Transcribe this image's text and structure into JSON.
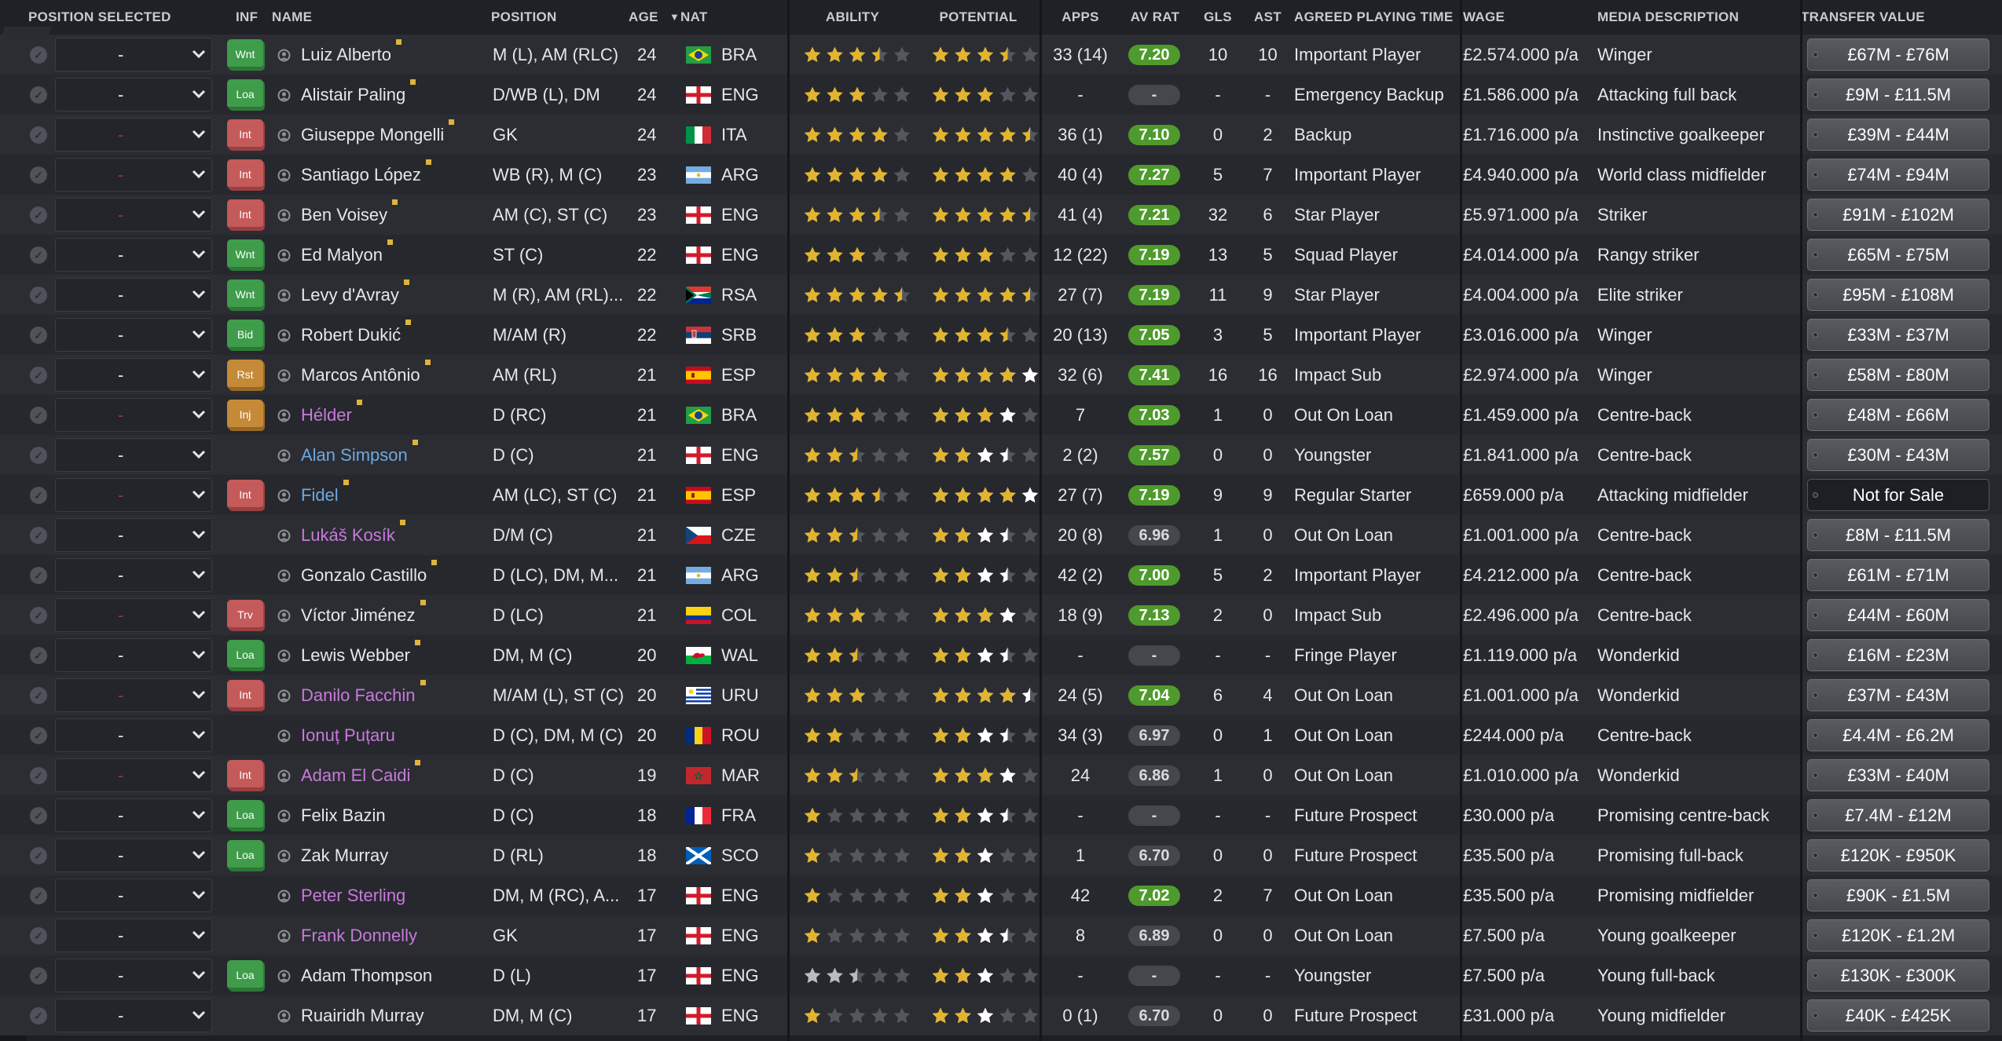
{
  "headers": {
    "position_selected": "POSITION SELECTED",
    "inf": "INF",
    "name": "NAME",
    "position": "POSITION",
    "age": "AGE",
    "nat": "NAT",
    "ability": "ABILITY",
    "potential": "POTENTIAL",
    "apps": "APPS",
    "av_rat": "AV RAT",
    "gls": "GLS",
    "ast": "AST",
    "agreed_playing_time": "AGREED PLAYING TIME",
    "wage": "WAGE",
    "media_description": "MEDIA DESCRIPTION",
    "transfer_value": "TRANSFER VALUE"
  },
  "sort": {
    "column": "age",
    "direction": "descending"
  },
  "colors": {
    "star_gold": "#e2b42f",
    "star_white": "#ffffff",
    "star_grey": "#55575e",
    "star_silver": "#b9bbc1",
    "rating_green": "#4f9a2c",
    "rating_grey": "#45474e",
    "name_purple": "#c77ad9",
    "name_blue": "#6fa8dc"
  },
  "players": [
    {
      "sel": "-",
      "sel_red": false,
      "badge": "Wnt",
      "badge_color": "green",
      "name": "Luiz Alberto",
      "name_color": "white",
      "dot": true,
      "position": "M (L), AM (RLC)",
      "age": "24",
      "flag": "brazil",
      "nat": "BRA",
      "ability": 3.5,
      "ability_color": "gold",
      "potential": 3.5,
      "potential_color": "gold",
      "apps": "33 (14)",
      "av_rat": "7.20",
      "rat_color": "green",
      "gls": "10",
      "ast": "10",
      "apt": "Important Player",
      "wage": "£2.574.000 p/a",
      "media": "Winger",
      "tv": "£67M - £76M"
    },
    {
      "sel": "-",
      "sel_red": false,
      "badge": "Loa",
      "badge_color": "green",
      "name": "Alistair Paling",
      "name_color": "white",
      "dot": true,
      "position": "D/WB (L), DM",
      "age": "24",
      "flag": "england",
      "nat": "ENG",
      "ability": 3,
      "ability_color": "gold",
      "potential": 3,
      "potential_color": "gold",
      "apps": "-",
      "av_rat": "-",
      "rat_color": "grey",
      "gls": "-",
      "ast": "-",
      "apt": "Emergency Backup",
      "wage": "£1.586.000 p/a",
      "media": "Attacking full back",
      "tv": "£9M - £11.5M"
    },
    {
      "sel": "-",
      "sel_red": true,
      "badge": "Int",
      "badge_color": "red",
      "name": "Giuseppe Mongelli",
      "name_color": "white",
      "dot": true,
      "position": "GK",
      "age": "24",
      "flag": "italy",
      "nat": "ITA",
      "ability": 4,
      "ability_color": "gold",
      "potential": 4.5,
      "potential_color": "gold",
      "apps": "36 (1)",
      "av_rat": "7.10",
      "rat_color": "green",
      "gls": "0",
      "ast": "2",
      "apt": "Backup",
      "wage": "£1.716.000 p/a",
      "media": "Instinctive goalkeeper",
      "tv": "£39M - £44M"
    },
    {
      "sel": "-",
      "sel_red": true,
      "badge": "Int",
      "badge_color": "red",
      "name": "Santiago López",
      "name_color": "white",
      "dot": true,
      "position": "WB (R), M (C)",
      "age": "23",
      "flag": "argentina",
      "nat": "ARG",
      "ability": 4,
      "ability_color": "gold",
      "potential": 4,
      "potential_color": "gold",
      "apps": "40 (4)",
      "av_rat": "7.27",
      "rat_color": "green",
      "gls": "5",
      "ast": "7",
      "apt": "Important Player",
      "wage": "£4.940.000 p/a",
      "media": "World class midfielder",
      "tv": "£74M - £94M"
    },
    {
      "sel": "-",
      "sel_red": true,
      "badge": "Int",
      "badge_color": "red",
      "name": "Ben Voisey",
      "name_color": "white",
      "dot": true,
      "position": "AM (C), ST (C)",
      "age": "23",
      "flag": "england",
      "nat": "ENG",
      "ability": 3.5,
      "ability_color": "gold",
      "potential": 4.5,
      "potential_color": "gold",
      "apps": "41 (4)",
      "av_rat": "7.21",
      "rat_color": "green",
      "gls": "32",
      "ast": "6",
      "apt": "Star Player",
      "wage": "£5.971.000 p/a",
      "media": "Striker",
      "tv": "£91M - £102M"
    },
    {
      "sel": "-",
      "sel_red": false,
      "badge": "Wnt",
      "badge_color": "green",
      "name": "Ed Malyon",
      "name_color": "white",
      "dot": true,
      "position": "ST (C)",
      "age": "22",
      "flag": "england",
      "nat": "ENG",
      "ability": 3,
      "ability_color": "gold",
      "potential": 3,
      "potential_color": "gold",
      "apps": "12 (22)",
      "av_rat": "7.19",
      "rat_color": "green",
      "gls": "13",
      "ast": "5",
      "apt": "Squad Player",
      "wage": "£4.014.000 p/a",
      "media": "Rangy striker",
      "tv": "£65M - £75M"
    },
    {
      "sel": "-",
      "sel_red": false,
      "badge": "Wnt",
      "badge_color": "green",
      "name": "Levy d'Avray",
      "name_color": "white",
      "dot": true,
      "position": "M (R), AM (RL)...",
      "age": "22",
      "flag": "south-africa",
      "nat": "RSA",
      "ability": 4.5,
      "ability_color": "gold",
      "potential": 4.5,
      "potential_color": "gold",
      "apps": "27 (7)",
      "av_rat": "7.19",
      "rat_color": "green",
      "gls": "11",
      "ast": "9",
      "apt": "Star Player",
      "wage": "£4.004.000 p/a",
      "media": "Elite striker",
      "tv": "£95M - £108M"
    },
    {
      "sel": "-",
      "sel_red": false,
      "badge": "Bid",
      "badge_color": "green",
      "name": "Robert Dukić",
      "name_color": "white",
      "dot": true,
      "position": "M/AM (R)",
      "age": "22",
      "flag": "serbia",
      "nat": "SRB",
      "ability": 3,
      "ability_color": "gold",
      "potential": 3.5,
      "potential_color": "gold",
      "apps": "20 (13)",
      "av_rat": "7.05",
      "rat_color": "green",
      "gls": "3",
      "ast": "5",
      "apt": "Important Player",
      "wage": "£3.016.000 p/a",
      "media": "Winger",
      "tv": "£33M - £37M"
    },
    {
      "sel": "-",
      "sel_red": false,
      "badge": "Rst",
      "badge_color": "yellow",
      "name": "Marcos Antônio",
      "name_color": "white",
      "dot": true,
      "position": "AM (RL)",
      "age": "21",
      "flag": "spain",
      "nat": "ESP",
      "ability": 4,
      "ability_color": "gold",
      "potential": 4,
      "potential_color": "gold",
      "potential_white": 1,
      "apps": "32 (6)",
      "av_rat": "7.41",
      "rat_color": "green",
      "gls": "16",
      "ast": "16",
      "apt": "Impact Sub",
      "wage": "£2.974.000 p/a",
      "media": "Winger",
      "tv": "£58M - £80M"
    },
    {
      "sel": "-",
      "sel_red": true,
      "badge": "Inj",
      "badge_color": "yellow",
      "name": "Hélder",
      "name_color": "purple",
      "dot": true,
      "position": "D (RC)",
      "age": "21",
      "flag": "brazil",
      "nat": "BRA",
      "ability": 3,
      "ability_color": "gold",
      "potential": 3,
      "potential_color": "gold",
      "potential_white": 1,
      "apps": "7",
      "av_rat": "7.03",
      "rat_color": "green",
      "gls": "1",
      "ast": "0",
      "apt": "Out On Loan",
      "wage": "£1.459.000 p/a",
      "media": "Centre-back",
      "tv": "£48M - £66M"
    },
    {
      "sel": "-",
      "sel_red": false,
      "badge": "",
      "badge_color": "",
      "name": "Alan Simpson",
      "name_color": "blue",
      "dot": true,
      "position": "D (C)",
      "age": "21",
      "flag": "england",
      "nat": "ENG",
      "ability": 2.5,
      "ability_color": "gold",
      "potential": 2,
      "potential_color": "gold",
      "potential_white": 1.5,
      "apps": "2 (2)",
      "av_rat": "7.57",
      "rat_color": "green",
      "gls": "0",
      "ast": "0",
      "apt": "Youngster",
      "wage": "£1.841.000 p/a",
      "media": "Centre-back",
      "tv": "£30M - £43M"
    },
    {
      "sel": "-",
      "sel_red": true,
      "badge": "Int",
      "badge_color": "red",
      "name": "Fidel",
      "name_color": "blue",
      "dot": true,
      "position": "AM (LC), ST (C)",
      "age": "21",
      "flag": "spain",
      "nat": "ESP",
      "ability": 3.5,
      "ability_color": "gold",
      "potential": 4,
      "potential_color": "gold",
      "potential_white": 1,
      "apps": "27 (7)",
      "av_rat": "7.19",
      "rat_color": "green",
      "gls": "9",
      "ast": "9",
      "apt": "Regular Starter",
      "wage": "£659.000 p/a",
      "media": "Attacking midfielder",
      "tv": "Not for Sale",
      "tv_dark": true
    },
    {
      "sel": "-",
      "sel_red": false,
      "badge": "",
      "badge_color": "",
      "name": "Lukáš Kosík",
      "name_color": "purple",
      "dot": true,
      "position": "D/M (C)",
      "age": "21",
      "flag": "czech",
      "nat": "CZE",
      "ability": 2.5,
      "ability_color": "gold",
      "potential": 2,
      "potential_color": "gold",
      "potential_white": 1.5,
      "apps": "20 (8)",
      "av_rat": "6.96",
      "rat_color": "grey",
      "gls": "1",
      "ast": "0",
      "apt": "Out On Loan",
      "wage": "£1.001.000 p/a",
      "media": "Centre-back",
      "tv": "£8M - £11.5M"
    },
    {
      "sel": "-",
      "sel_red": false,
      "badge": "",
      "badge_color": "",
      "name": "Gonzalo Castillo",
      "name_color": "white",
      "dot": true,
      "position": "D (LC), DM, M...",
      "age": "21",
      "flag": "argentina",
      "nat": "ARG",
      "ability": 2.5,
      "ability_color": "gold",
      "potential": 2,
      "potential_color": "gold",
      "potential_white": 1.5,
      "apps": "42 (2)",
      "av_rat": "7.00",
      "rat_color": "green",
      "gls": "5",
      "ast": "2",
      "apt": "Important Player",
      "wage": "£4.212.000 p/a",
      "media": "Centre-back",
      "tv": "£61M - £71M"
    },
    {
      "sel": "-",
      "sel_red": true,
      "badge": "Trv",
      "badge_color": "red",
      "name": "Víctor Jiménez",
      "name_color": "white",
      "dot": true,
      "position": "D (LC)",
      "age": "21",
      "flag": "colombia",
      "nat": "COL",
      "ability": 3,
      "ability_color": "gold",
      "potential": 3,
      "potential_color": "gold",
      "potential_white": 1,
      "apps": "18 (9)",
      "av_rat": "7.13",
      "rat_color": "green",
      "gls": "2",
      "ast": "0",
      "apt": "Impact Sub",
      "wage": "£2.496.000 p/a",
      "media": "Centre-back",
      "tv": "£44M - £60M"
    },
    {
      "sel": "-",
      "sel_red": false,
      "badge": "Loa",
      "badge_color": "green",
      "name": "Lewis Webber",
      "name_color": "white",
      "dot": true,
      "position": "DM, M (C)",
      "age": "20",
      "flag": "wales",
      "nat": "WAL",
      "ability": 2.5,
      "ability_color": "gold",
      "potential": 2,
      "potential_color": "gold",
      "potential_white": 1.5,
      "apps": "-",
      "av_rat": "-",
      "rat_color": "grey",
      "gls": "-",
      "ast": "-",
      "apt": "Fringe Player",
      "wage": "£1.119.000 p/a",
      "media": "Wonderkid",
      "tv": "£16M - £23M"
    },
    {
      "sel": "-",
      "sel_red": true,
      "badge": "Int",
      "badge_color": "red",
      "name": "Danilo Facchin",
      "name_color": "purple",
      "dot": true,
      "position": "M/AM (L), ST (C)",
      "age": "20",
      "flag": "uruguay",
      "nat": "URU",
      "ability": 3,
      "ability_color": "gold",
      "potential": 4,
      "potential_color": "gold",
      "potential_white": 0.5,
      "apps": "24 (5)",
      "av_rat": "7.04",
      "rat_color": "green",
      "gls": "6",
      "ast": "4",
      "apt": "Out On Loan",
      "wage": "£1.001.000 p/a",
      "media": "Wonderkid",
      "tv": "£37M - £43M"
    },
    {
      "sel": "-",
      "sel_red": false,
      "badge": "",
      "badge_color": "",
      "name": "Ionuț Puțaru",
      "name_color": "purple",
      "dot": false,
      "position": "D (C), DM, M (C)",
      "age": "20",
      "flag": "romania",
      "nat": "ROU",
      "ability": 2,
      "ability_color": "gold",
      "potential": 2,
      "potential_color": "gold",
      "potential_white": 1.5,
      "apps": "34 (3)",
      "av_rat": "6.97",
      "rat_color": "grey",
      "gls": "0",
      "ast": "1",
      "apt": "Out On Loan",
      "wage": "£244.000 p/a",
      "media": "Centre-back",
      "tv": "£4.4M - £6.2M"
    },
    {
      "sel": "-",
      "sel_red": true,
      "badge": "Int",
      "badge_color": "red",
      "name": "Adam El Caidi",
      "name_color": "purple",
      "dot": true,
      "position": "D (C)",
      "age": "19",
      "flag": "morocco",
      "nat": "MAR",
      "ability": 2.5,
      "ability_color": "gold",
      "potential": 3,
      "potential_color": "gold",
      "potential_white": 1,
      "apps": "24",
      "av_rat": "6.86",
      "rat_color": "grey",
      "gls": "1",
      "ast": "0",
      "apt": "Out On Loan",
      "wage": "£1.010.000 p/a",
      "media": "Wonderkid",
      "tv": "£33M - £40M"
    },
    {
      "sel": "-",
      "sel_red": false,
      "badge": "Loa",
      "badge_color": "green",
      "name": "Felix Bazin",
      "name_color": "white",
      "dot": false,
      "position": "D (C)",
      "age": "18",
      "flag": "france",
      "nat": "FRA",
      "ability": 1,
      "ability_color": "gold",
      "potential": 2,
      "potential_color": "gold",
      "potential_white": 1.5,
      "apps": "-",
      "av_rat": "-",
      "rat_color": "grey",
      "gls": "-",
      "ast": "-",
      "apt": "Future Prospect",
      "wage": "£30.000 p/a",
      "media": "Promising centre-back",
      "tv": "£7.4M - £12M"
    },
    {
      "sel": "-",
      "sel_red": false,
      "badge": "Loa",
      "badge_color": "green",
      "name": "Zak Murray",
      "name_color": "white",
      "dot": false,
      "position": "D (RL)",
      "age": "18",
      "flag": "scotland",
      "nat": "SCO",
      "ability": 1,
      "ability_color": "gold",
      "potential": 2,
      "potential_color": "gold",
      "potential_white": 1,
      "apps": "1",
      "av_rat": "6.70",
      "rat_color": "grey",
      "gls": "0",
      "ast": "0",
      "apt": "Future Prospect",
      "wage": "£35.500 p/a",
      "media": "Promising full-back",
      "tv": "£120K - £950K"
    },
    {
      "sel": "-",
      "sel_red": false,
      "badge": "",
      "badge_color": "",
      "name": "Peter Sterling",
      "name_color": "purple",
      "dot": false,
      "position": "DM, M (RC), A...",
      "age": "17",
      "flag": "england",
      "nat": "ENG",
      "ability": 1,
      "ability_color": "gold",
      "potential": 2,
      "potential_color": "gold",
      "potential_white": 1,
      "apps": "42",
      "av_rat": "7.02",
      "rat_color": "green",
      "gls": "2",
      "ast": "7",
      "apt": "Out On Loan",
      "wage": "£35.500 p/a",
      "media": "Promising midfielder",
      "tv": "£90K - £1.5M"
    },
    {
      "sel": "-",
      "sel_red": false,
      "badge": "",
      "badge_color": "",
      "name": "Frank Donnelly",
      "name_color": "purple",
      "dot": false,
      "position": "GK",
      "age": "17",
      "flag": "england",
      "nat": "ENG",
      "ability": 1,
      "ability_color": "gold",
      "potential": 2,
      "potential_color": "gold",
      "potential_white": 1.5,
      "apps": "8",
      "av_rat": "6.89",
      "rat_color": "grey",
      "gls": "0",
      "ast": "0",
      "apt": "Out On Loan",
      "wage": "£7.500 p/a",
      "media": "Young goalkeeper",
      "tv": "£120K - £1.2M"
    },
    {
      "sel": "-",
      "sel_red": false,
      "badge": "Loa",
      "badge_color": "green",
      "name": "Adam Thompson",
      "name_color": "white",
      "dot": false,
      "position": "D (L)",
      "age": "17",
      "flag": "england",
      "nat": "ENG",
      "ability": 2.5,
      "ability_color": "silver",
      "potential": 2,
      "potential_color": "gold",
      "potential_white": 1,
      "apps": "-",
      "av_rat": "-",
      "rat_color": "grey",
      "gls": "-",
      "ast": "-",
      "apt": "Youngster",
      "wage": "£7.500 p/a",
      "media": "Young full-back",
      "tv": "£130K - £300K"
    },
    {
      "sel": "-",
      "sel_red": false,
      "badge": "",
      "badge_color": "",
      "name": "Ruairidh Murray",
      "name_color": "white",
      "dot": false,
      "position": "DM, M (C)",
      "age": "17",
      "flag": "england",
      "nat": "ENG",
      "ability": 1,
      "ability_color": "gold",
      "potential": 2,
      "potential_color": "gold",
      "potential_white": 1,
      "apps": "0 (1)",
      "av_rat": "6.70",
      "rat_color": "grey",
      "gls": "0",
      "ast": "0",
      "apt": "Future Prospect",
      "wage": "£31.000 p/a",
      "media": "Young midfielder",
      "tv": "£40K - £425K"
    }
  ]
}
